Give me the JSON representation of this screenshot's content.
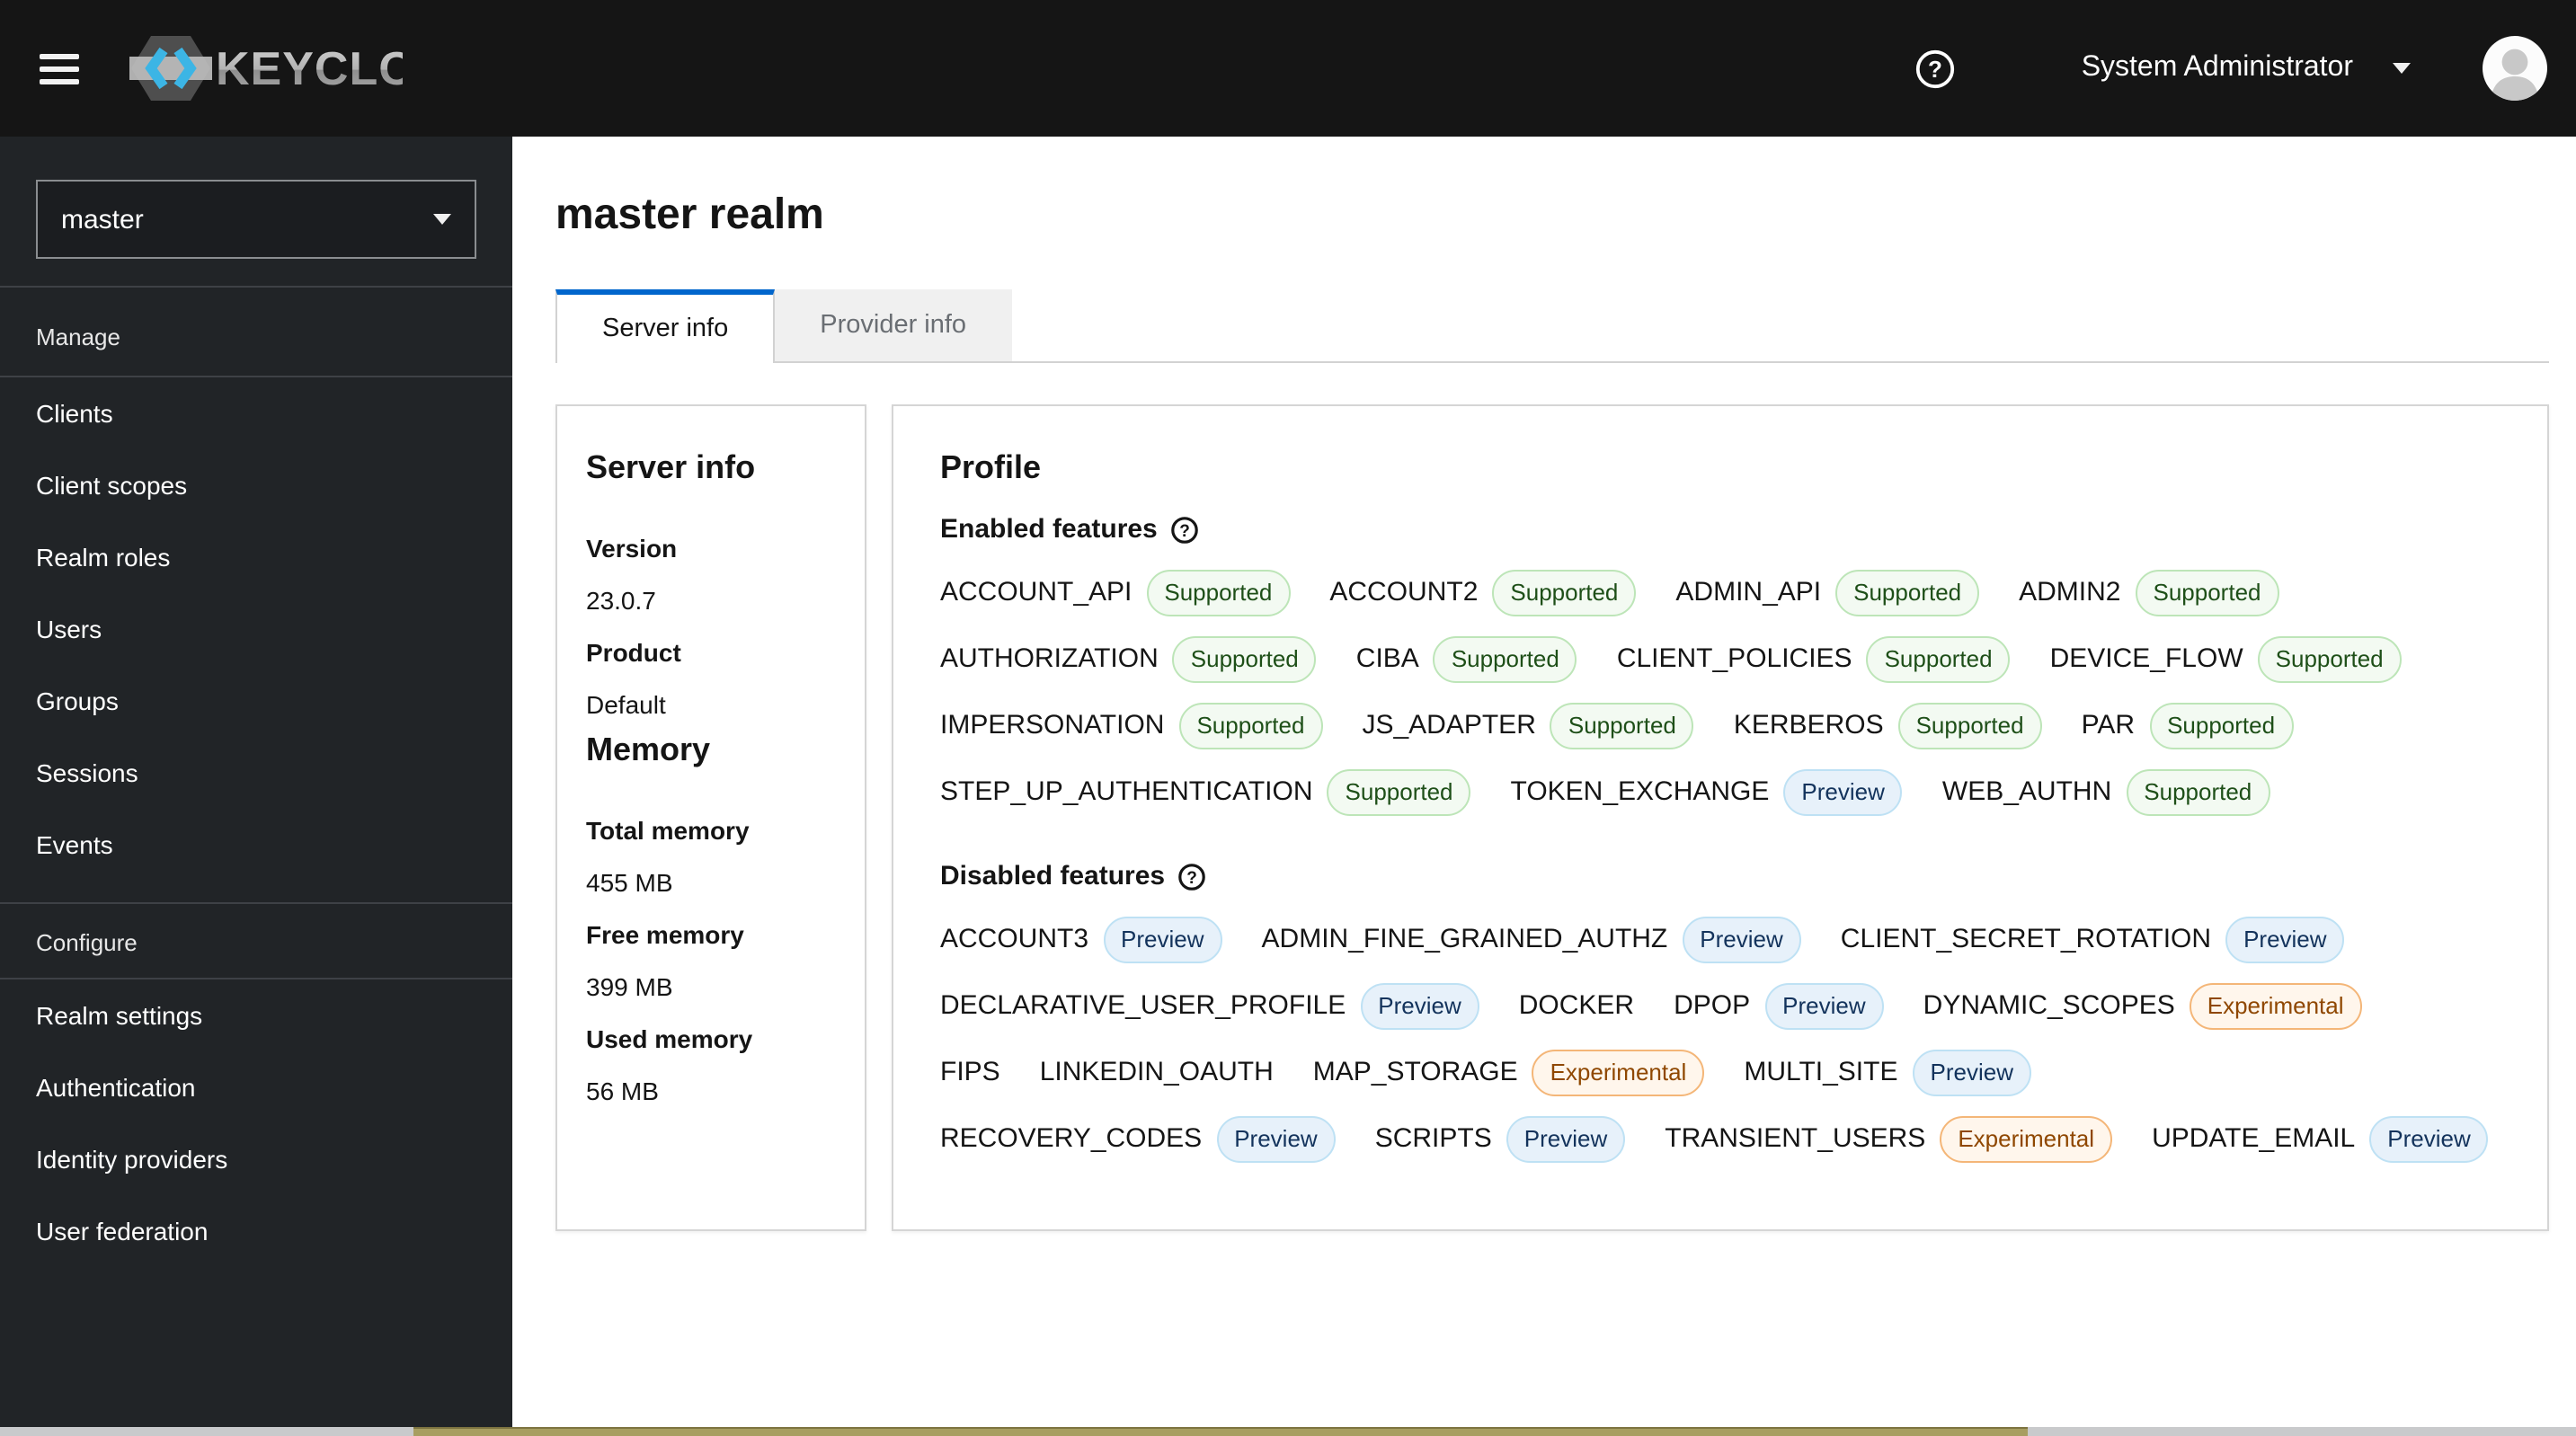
{
  "header": {
    "product_name": "KEYCLOAK",
    "user": "System Administrator"
  },
  "sidebar": {
    "realm": "master",
    "groups": [
      {
        "label": "Manage",
        "items": [
          "Clients",
          "Client scopes",
          "Realm roles",
          "Users",
          "Groups",
          "Sessions",
          "Events"
        ]
      },
      {
        "label": "Configure",
        "items": [
          "Realm settings",
          "Authentication",
          "Identity providers",
          "User federation"
        ]
      }
    ]
  },
  "page": {
    "title": "master realm",
    "tabs": [
      {
        "label": "Server info",
        "active": true
      },
      {
        "label": "Provider info",
        "active": false
      }
    ]
  },
  "server_info": {
    "heading": "Server info",
    "fields": [
      {
        "label": "Version",
        "value": "23.0.7"
      },
      {
        "label": "Product",
        "value": "Default"
      }
    ],
    "memory_heading": "Memory",
    "memory_fields": [
      {
        "label": "Total memory",
        "value": "455 MB"
      },
      {
        "label": "Free memory",
        "value": "399 MB"
      },
      {
        "label": "Used memory",
        "value": "56 MB"
      }
    ]
  },
  "profile": {
    "heading": "Profile",
    "enabled_label": "Enabled features",
    "disabled_label": "Disabled features",
    "enabled_rows": [
      [
        {
          "name": "ACCOUNT_API",
          "badge": "Supported"
        },
        {
          "name": "ACCOUNT2",
          "badge": "Supported"
        },
        {
          "name": "ADMIN_API",
          "badge": "Supported"
        },
        {
          "name": "ADMIN2",
          "badge": "Supported"
        }
      ],
      [
        {
          "name": "AUTHORIZATION",
          "badge": "Supported"
        },
        {
          "name": "CIBA",
          "badge": "Supported"
        },
        {
          "name": "CLIENT_POLICIES",
          "badge": "Supported"
        },
        {
          "name": "DEVICE_FLOW",
          "badge": "Supported"
        }
      ],
      [
        {
          "name": "IMPERSONATION",
          "badge": "Supported"
        },
        {
          "name": "JS_ADAPTER",
          "badge": "Supported"
        },
        {
          "name": "KERBEROS",
          "badge": "Supported"
        },
        {
          "name": "PAR",
          "badge": "Supported"
        }
      ],
      [
        {
          "name": "STEP_UP_AUTHENTICATION",
          "badge": "Supported"
        },
        {
          "name": "TOKEN_EXCHANGE",
          "badge": "Preview"
        },
        {
          "name": "WEB_AUTHN",
          "badge": "Supported"
        }
      ]
    ],
    "disabled_rows": [
      [
        {
          "name": "ACCOUNT3",
          "badge": "Preview"
        },
        {
          "name": "ADMIN_FINE_GRAINED_AUTHZ",
          "badge": "Preview"
        },
        {
          "name": "CLIENT_SECRET_ROTATION",
          "badge": "Preview"
        }
      ],
      [
        {
          "name": "DECLARATIVE_USER_PROFILE",
          "badge": "Preview"
        },
        {
          "name": "DOCKER",
          "badge": null
        },
        {
          "name": "DPOP",
          "badge": "Preview"
        },
        {
          "name": "DYNAMIC_SCOPES",
          "badge": "Experimental"
        }
      ],
      [
        {
          "name": "FIPS",
          "badge": null
        },
        {
          "name": "LINKEDIN_OAUTH",
          "badge": null
        },
        {
          "name": "MAP_STORAGE",
          "badge": "Experimental"
        },
        {
          "name": "MULTI_SITE",
          "badge": "Preview"
        }
      ],
      [
        {
          "name": "RECOVERY_CODES",
          "badge": "Preview"
        },
        {
          "name": "SCRIPTS",
          "badge": "Preview"
        },
        {
          "name": "TRANSIENT_USERS",
          "badge": "Experimental"
        },
        {
          "name": "UPDATE_EMAIL",
          "badge": "Preview"
        }
      ]
    ]
  },
  "icons": {
    "menu": "hamburger-three-bars",
    "help": "question-circle",
    "chevron_down": "caret-down",
    "feature_help": "question-circle"
  },
  "colors": {
    "masthead_bg": "#151515",
    "sidebar_bg": "#212427",
    "accent_tab": "#0066cc",
    "badge_supported": {
      "bg": "#f3faf2",
      "border": "#bde5b8",
      "text": "#1e4f18"
    },
    "badge_preview": {
      "bg": "#e7f1fa",
      "border": "#bee1f4",
      "text": "#13335c"
    },
    "badge_experimental": {
      "bg": "#fff6ec",
      "border": "#f4b678",
      "text": "#8f4700"
    },
    "scrollbar_thumb": "#a89e61"
  }
}
